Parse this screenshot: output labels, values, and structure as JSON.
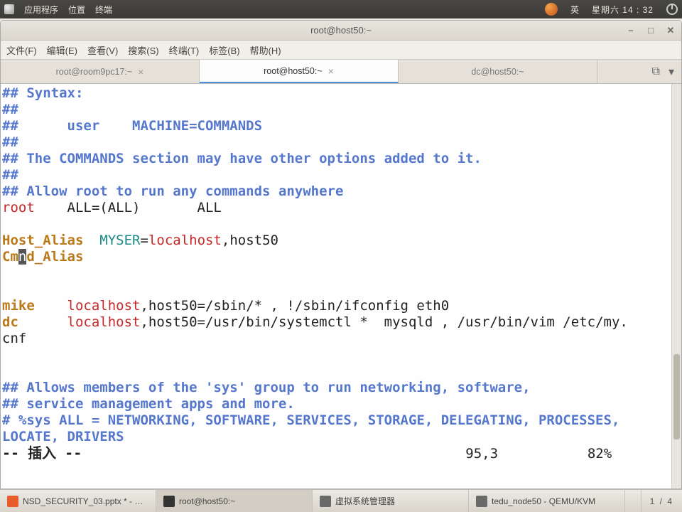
{
  "panel": {
    "apps": "应用程序",
    "places": "位置",
    "terminal": "终端",
    "ime": "英",
    "date": "星期六 14 : 32"
  },
  "titlebar": {
    "title": "root@host50:~"
  },
  "menu": {
    "file": "文件(F)",
    "edit": "编辑(E)",
    "view": "查看(V)",
    "search": "搜索(S)",
    "terminal": "终端(T)",
    "tabs": "标签(B)",
    "help": "帮助(H)"
  },
  "tabs": {
    "t1": "root@room9pc17:~",
    "t2": "root@host50:~",
    "t3": "dc@host50:~"
  },
  "term": {
    "l1a": "## Syntax:",
    "l2": "##",
    "l3": "##      user    MACHINE=COMMANDS",
    "l4": "##",
    "l5": "## The COMMANDS section may have other options added to it.",
    "l6": "##",
    "l7": "## Allow root to run any commands anywhere",
    "l8_root": "root",
    "l8_rest": "    ALL=(ALL)       ALL",
    "l9_ha": "Host_Alias",
    "l9_my": "MYSER",
    "l9_eq": "=",
    "l9_lh": "localhost",
    "l9_rest": ",host50",
    "l10_a": "Cm",
    "l10_cur": "n",
    "l10_b": "d_Alias",
    "l12_mike": "mike",
    "l12_lh": "localhost",
    "l12_rest": ",host50=/sbin/* , !/sbin/ifconfig eth0",
    "l13_dc": "dc",
    "l13_lh": "localhost",
    "l13_rest": ",host50=/usr/bin/systemctl *  mysqld , /usr/bin/vim /etc/my.",
    "l14": "cnf",
    "l16": "## Allows members of the 'sys' group to run networking, software,",
    "l17": "## service management apps and more.",
    "l18": "# %sys ALL = NETWORKING, SOFTWARE, SERVICES, STORAGE, DELEGATING, PROCESSES, ",
    "l19": "LOCATE, DRIVERS",
    "status_mode": "-- 插入 --",
    "status_pos": "95,3",
    "status_pct": "82%"
  },
  "taskbar": {
    "t1": "NSD_SECURITY_03.pptx * - W…",
    "t2": "root@host50:~",
    "t3": "虚拟系统管理器",
    "t4": "tedu_node50 - QEMU/KVM",
    "ws": "1 / 4"
  }
}
